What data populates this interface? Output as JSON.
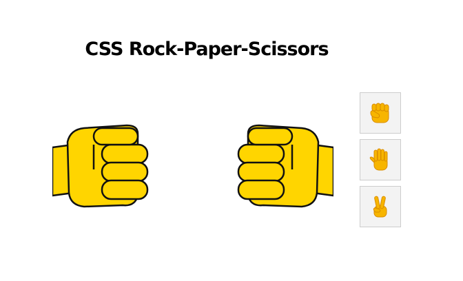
{
  "title": "CSS Rock-Paper-Scissors",
  "colors": {
    "fist_fill": "#FFD500",
    "fist_outline": "#111111",
    "emoji_fill": "#F7B500",
    "button_border": "#CCCCCC",
    "button_bg": "#F3F3F3"
  },
  "players": {
    "left": {
      "gesture": "rock",
      "icon": "fist-icon"
    },
    "right": {
      "gesture": "rock",
      "icon": "fist-icon"
    }
  },
  "choices": [
    {
      "gesture": "rock",
      "icon": "raised-fist-icon"
    },
    {
      "gesture": "paper",
      "icon": "raised-hand-icon"
    },
    {
      "gesture": "scissors",
      "icon": "victory-hand-icon"
    }
  ]
}
